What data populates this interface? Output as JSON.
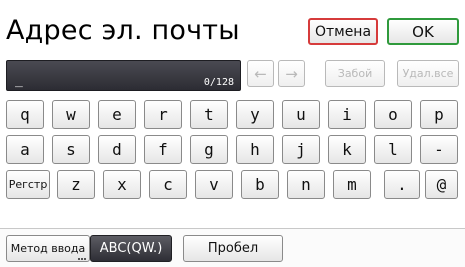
{
  "header": {
    "title": "Адрес эл. почты"
  },
  "actions": {
    "cancel_label": "Отмена",
    "ok_label": "OK"
  },
  "input": {
    "value": "_",
    "counter": "0/128"
  },
  "edit_controls": {
    "left_arrow": "←",
    "right_arrow": "→",
    "backspace_label": "Забой",
    "delete_all_label": "Удал.все"
  },
  "keyboard": {
    "row1": [
      "q",
      "w",
      "e",
      "r",
      "t",
      "y",
      "u",
      "i",
      "o",
      "p"
    ],
    "row2": [
      "a",
      "s",
      "d",
      "f",
      "g",
      "h",
      "j",
      "k",
      "l",
      "-"
    ],
    "shift_label": "Регстр",
    "row3": [
      "z",
      "x",
      "c",
      "v",
      "b",
      "n",
      "m",
      ".",
      "@"
    ]
  },
  "bottom": {
    "input_method_label": "Метод ввода",
    "mode_label": "ABC(QW.)",
    "space_label": "Пробел"
  }
}
